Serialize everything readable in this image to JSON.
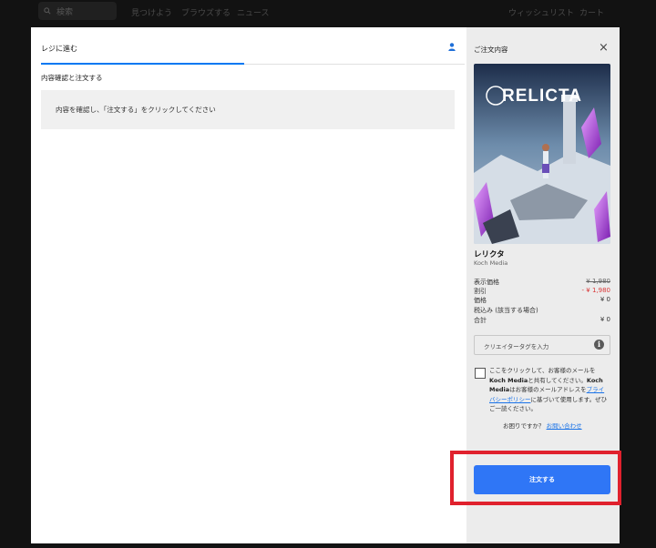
{
  "store_nav": {
    "search_placeholder": "検索",
    "items": [
      "見つけよう",
      "ブラウズする",
      "ニュース"
    ],
    "wishlist": "ウィッシュリスト",
    "cart": "カート"
  },
  "checkout": {
    "tab_label": "レジに進む",
    "section_title": "内容確認と注文する",
    "notice": "内容を確認し、「注文する」をクリックしてください"
  },
  "summary": {
    "title": "ご注文内容",
    "close": "×",
    "cover_logo": "RELICTA",
    "game_name": "レリクタ",
    "publisher": "Koch Media",
    "prices": [
      {
        "label": "表示価格",
        "value": "¥ 1,980"
      },
      {
        "label": "割引",
        "value": "- ¥ 1,980"
      },
      {
        "label": "価格",
        "value": "¥ 0"
      },
      {
        "label": "税込み (該当する場合)",
        "value": ""
      },
      {
        "label": "合計",
        "value": "¥ 0"
      }
    ],
    "creator_tag_placeholder": "クリエイタータグを入力",
    "info": "i",
    "consent": {
      "p1": "ここをクリックして、お客様のメールを",
      "b1": "Koch Media",
      "p2": "と共有してください。",
      "b2": "Koch Media",
      "p3": "はお客様のメールアドレスを",
      "link": "プライバシーポリシー",
      "p4": "に基づいて使用します。ぜひご一読ください。"
    },
    "help_text": "お困りですか？",
    "help_link": "お問い合わせ",
    "order_button": "注文する"
  },
  "colors": {
    "accent": "#0078f2",
    "order_button": "#2f76f6",
    "annotation": "#e0212d",
    "discount": "#d93636"
  }
}
